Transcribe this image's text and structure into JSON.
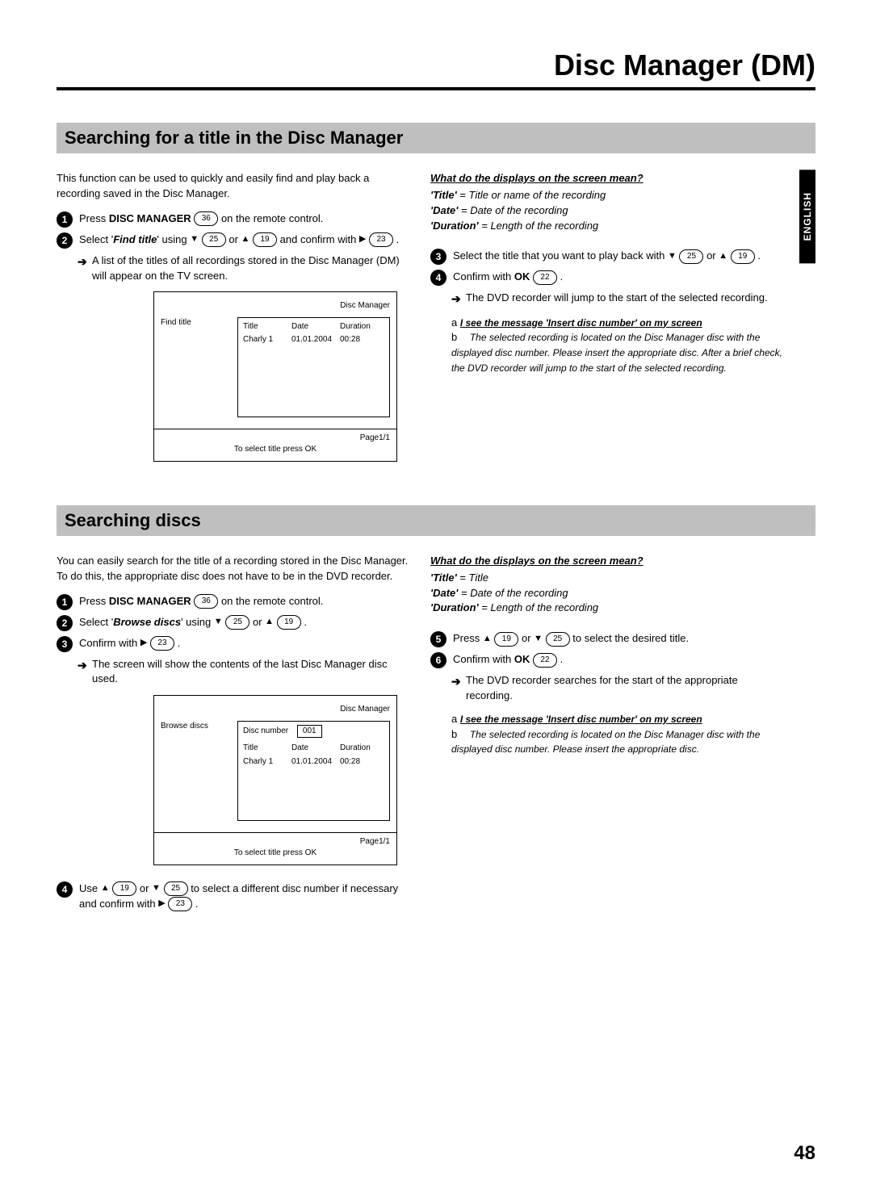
{
  "chapterTitle": "Disc Manager (DM)",
  "langTab": "ENGLISH",
  "pageNumber": "48",
  "sectionA": {
    "heading": "Searching for a title in the Disc Manager",
    "intro": "This function can be used to quickly and easily find and play back a recording saved in the Disc Manager.",
    "step1_pre": "Press ",
    "step1_btn": "DISC MANAGER",
    "step1_num": "36",
    "step1_post": " on the remote control.",
    "step2_pre": "Select '",
    "step2_item": "Find title",
    "step2_mid1": "' using ",
    "step2_num1": "25",
    "step2_mid2": " or ",
    "step2_num2": "19",
    "step2_mid3": " and confirm with ",
    "step2_num3": "23",
    "step2_end": " .",
    "step2_sub": "A list of the titles of all recordings stored in the Disc Manager (DM) will appear on the TV screen.",
    "info_title": "What do the displays on the screen mean?",
    "info_l1a": "'Title'",
    "info_l1b": " = Title or name of the recording",
    "info_l2a": "'Date'",
    "info_l2b": " = Date of the recording",
    "info_l3a": "'Duration'",
    "info_l3b": " = Length of the recording",
    "step3_pre": "Select the title that you want to play back with ",
    "step3_num1": "25",
    "step3_mid": " or ",
    "step3_num2": "19",
    "step3_end": " .",
    "step4_pre": "Confirm with ",
    "step4_btn": "OK",
    "step4_num": "22",
    "step4_end": " .",
    "step4_sub": "The DVD recorder will jump to the start of the selected recording.",
    "tA_label_a": "a ",
    "tA_q": "I see the message 'Insert disc number' on my screen",
    "tA_label_b": "b ",
    "tA_a": "The selected recording is located on the Disc Manager disc with the displayed disc number. Please insert the appropriate disc. After a brief check, the DVD recorder will jump to the start of the selected recording.",
    "screen": {
      "header": "Disc Manager",
      "left": "Find title",
      "colTitle": "Title",
      "colDate": "Date",
      "colDur": "Duration",
      "rowTitle": "Charly 1",
      "rowDate": "01.01.2004",
      "rowDur": "00:28",
      "pager": "Page1/1",
      "footer": "To select title press OK"
    }
  },
  "sectionB": {
    "heading": "Searching discs",
    "intro": "You can easily search for the title of a recording stored in the Disc Manager. To do this, the appropriate disc does not have to be in the DVD recorder.",
    "step1_pre": "Press ",
    "step1_btn": "DISC MANAGER",
    "step1_num": "36",
    "step1_post": " on the remote control.",
    "step2_pre": "Select '",
    "step2_item": "Browse discs",
    "step2_mid1": "' using ",
    "step2_num1": "25",
    "step2_mid2": " or ",
    "step2_num2": "19",
    "step2_end": " .",
    "step3_pre": "Confirm with ",
    "step3_num": "23",
    "step3_end": " .",
    "step3_sub": "The screen will show the contents of the last Disc Manager disc used.",
    "step4_pre": "Use ",
    "step4_num1": "19",
    "step4_mid1": " or ",
    "step4_num2": "25",
    "step4_mid2": " to select a different disc number if necessary and confirm with ",
    "step4_num3": "23",
    "step4_end": " .",
    "info_title": "What do the displays on the screen mean?",
    "info_l1a": "'Title'",
    "info_l1b": " = Title",
    "info_l2a": "'Date'",
    "info_l2b": " = Date of the recording",
    "info_l3a": "'Duration'",
    "info_l3b": " = Length of the recording",
    "step5_pre": "Press ",
    "step5_num1": "19",
    "step5_mid": " or ",
    "step5_num2": "25",
    "step5_post": " to select the desired title.",
    "step6_pre": "Confirm with ",
    "step6_btn": "OK",
    "step6_num": "22",
    "step6_end": " .",
    "step6_sub": "The DVD recorder searches for the start of the appropriate recording.",
    "tB_label_a": "a ",
    "tB_q": "I see the message 'Insert disc number' on my screen",
    "tB_label_b": "b ",
    "tB_a": "The selected recording is located on the Disc Manager disc with the displayed disc number. Please insert the appropriate disc.",
    "screen": {
      "header": "Disc Manager",
      "left": "Browse discs",
      "discNumLabel": "Disc number",
      "discNumVal": "001",
      "colTitle": "Title",
      "colDate": "Date",
      "colDur": "Duration",
      "rowTitle": "Charly 1",
      "rowDate": "01.01.2004",
      "rowDur": "00:28",
      "pager": "Page1/1",
      "footer": "To select title press OK"
    }
  }
}
